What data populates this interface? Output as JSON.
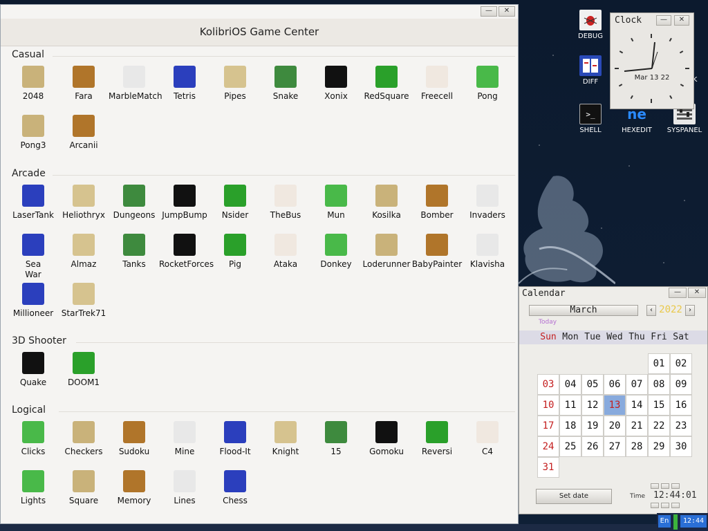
{
  "desktop": {
    "icons": [
      {
        "label": "DEBUG",
        "icon": "bug-icon"
      },
      {
        "label": "DIFF",
        "icon": "diff-icon"
      },
      {
        "label": "SHELL",
        "icon": "terminal-icon"
      },
      {
        "label": "HEXEDIT",
        "icon": "hexedit-icon"
      },
      {
        "label": "SYSPANEL",
        "icon": "syspanel-icon"
      },
      {
        "label": "K",
        "icon": "partial-icon"
      }
    ]
  },
  "game_center": {
    "title": "KolibriOS Game Center",
    "minimize_glyph": "—",
    "close_glyph": "✕",
    "sections": [
      {
        "title": "Casual",
        "items": [
          "2048",
          "Fara",
          "MarbleMatch",
          "Tetris",
          "Pipes",
          "Snake",
          "Xonix",
          "RedSquare",
          "Freecell",
          "Pong",
          "Pong3",
          "Arcanii"
        ]
      },
      {
        "title": "Arcade",
        "items": [
          "LaserTank",
          "Heliothryx",
          "Dungeons",
          "JumpBump",
          "Nsider",
          "TheBus",
          "Mun",
          "Kosilka",
          "Bomber",
          "Invaders",
          "Sea War",
          "Almaz",
          "Tanks",
          "RocketForces",
          "Pig",
          "Ataka",
          "Donkey",
          "Loderunner",
          "BabyPainter",
          "Klavisha",
          "Millioneer",
          "StarTrek71"
        ]
      },
      {
        "title": "3D Shooter",
        "items": [
          "Quake",
          "DOOM1"
        ]
      },
      {
        "title": "Logical",
        "items": [
          "Clicks",
          "Checkers",
          "Sudoku",
          "Mine",
          "Flood-It",
          "Knight",
          "15",
          "Gomoku",
          "Reversi",
          "C4",
          "Lights",
          "Square",
          "Memory",
          "Lines",
          "Chess"
        ]
      }
    ]
  },
  "clock": {
    "title": "Clock",
    "date": "Mar 13 22",
    "time_shown": "12:44"
  },
  "calendar": {
    "title": "Calendar",
    "month": "March",
    "year": "2022",
    "today_label": "Today",
    "weekdays": [
      "Sun",
      "Mon",
      "Tue",
      "Wed",
      "Thu",
      "Fri",
      "Sat"
    ],
    "days": [
      "01",
      "02",
      "03",
      "04",
      "05",
      "06",
      "07",
      "08",
      "09",
      "10",
      "11",
      "12",
      "13",
      "14",
      "15",
      "16",
      "17",
      "18",
      "19",
      "20",
      "21",
      "22",
      "23",
      "24",
      "25",
      "26",
      "27",
      "28",
      "29",
      "30",
      "31"
    ],
    "first_weekday_index": 2,
    "selected_day": "13",
    "set_date_label": "Set date",
    "time_label": "Time",
    "time_value": "12:44:01",
    "colors": {
      "sunday": "#c41e1e",
      "year": "#e9c84a",
      "today": "#8ad"
    }
  },
  "tray": {
    "lang": "En",
    "time": "12:44"
  }
}
